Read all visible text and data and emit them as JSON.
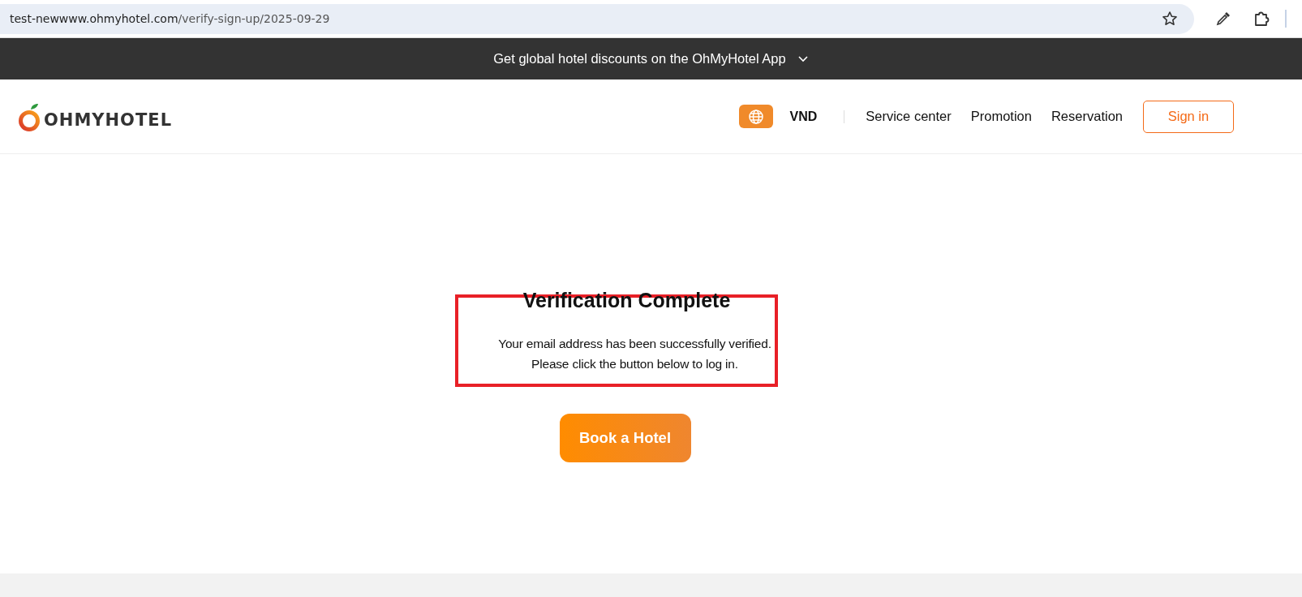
{
  "browser": {
    "url_host": "test-newwww.ohmyhotel.com",
    "url_path": "/verify-sign-up/2025-09-29"
  },
  "banner": {
    "text": "Get global hotel discounts on the OhMyHotel App"
  },
  "header": {
    "logo": "OHMYHOTEL",
    "currency": "VND",
    "nav": [
      "Service center",
      "Promotion",
      "Reservation"
    ],
    "sign_in": "Sign in"
  },
  "main": {
    "title": "Verification Complete",
    "message": [
      "Your email address has been successfully verified.",
      "Please click the button below to log in."
    ],
    "button": "Book a Hotel"
  }
}
